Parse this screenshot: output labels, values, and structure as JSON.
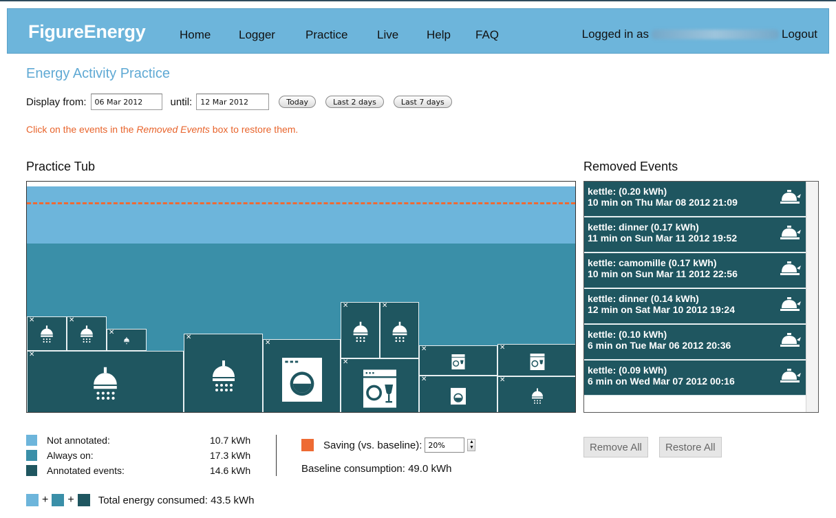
{
  "nav": {
    "brand": "FigureEnergy",
    "links": [
      "Home",
      "Logger",
      "Practice",
      "Live",
      "Help",
      "FAQ"
    ],
    "logged_in_prefix": "Logged in as",
    "logout": "Logout"
  },
  "page": {
    "title": "Energy Activity Practice",
    "display_from_label": "Display from:",
    "from_value": "06 Mar 2012",
    "until_label": "until:",
    "until_value": "12 Mar 2012",
    "buttons": {
      "today": "Today",
      "last2": "Last 2 days",
      "last7": "Last 7 days"
    },
    "hint_before": "Click on the events in the ",
    "hint_em": "Removed Events",
    "hint_after": " box to restore them."
  },
  "tub": {
    "title": "Practice Tub",
    "colors": {
      "not_annotated": "#6db5db",
      "always_on": "#3a8fa8",
      "annotated": "#1f5660",
      "baseline": "#ee6a33"
    },
    "events": [
      {
        "icon": "shower-icon"
      },
      {
        "icon": "shower-icon"
      },
      {
        "icon": "tap-icon"
      },
      {
        "icon": "shower-icon"
      },
      {
        "icon": "shower-icon"
      },
      {
        "icon": "washing-machine-icon"
      },
      {
        "icon": "shower-icon"
      },
      {
        "icon": "shower-icon"
      },
      {
        "icon": "dishwasher-icon"
      },
      {
        "icon": "dishwasher-icon"
      },
      {
        "icon": "dishwasher-icon"
      },
      {
        "icon": "washing-machine-icon"
      },
      {
        "icon": "shower-icon"
      }
    ]
  },
  "removed": {
    "title": "Removed Events",
    "items": [
      {
        "l1": "kettle: (0.20 kWh)",
        "l2": "10 min on Thu Mar 08 2012 21:09"
      },
      {
        "l1": "kettle: dinner (0.17 kWh)",
        "l2": "11 min on Sun Mar 11 2012 19:52"
      },
      {
        "l1": "kettle: camomille (0.17 kWh)",
        "l2": "10 min on Sun Mar 11 2012 22:56"
      },
      {
        "l1": "kettle: dinner (0.14 kWh)",
        "l2": "12 min on Sat Mar 10 2012 19:24"
      },
      {
        "l1": "kettle: (0.10 kWh)",
        "l2": "6 min on Tue Mar 06 2012 20:36"
      },
      {
        "l1": "kettle: (0.09 kWh)",
        "l2": "6 min on Wed Mar 07 2012 00:16"
      }
    ],
    "remove_all": "Remove All",
    "restore_all": "Restore All"
  },
  "legend": {
    "not_annotated": {
      "label": "Not annotated:",
      "value": "10.7 kWh"
    },
    "always_on": {
      "label": "Always on:",
      "value": "17.3 kWh"
    },
    "annotated": {
      "label": "Annotated events:",
      "value": "14.6 kWh"
    },
    "saving_label": "Saving (vs. baseline):",
    "saving_value": "20%",
    "baseline_text": "Baseline consumption: 49.0 kWh",
    "total_text": "Total energy consumed: 43.5 kWh"
  }
}
